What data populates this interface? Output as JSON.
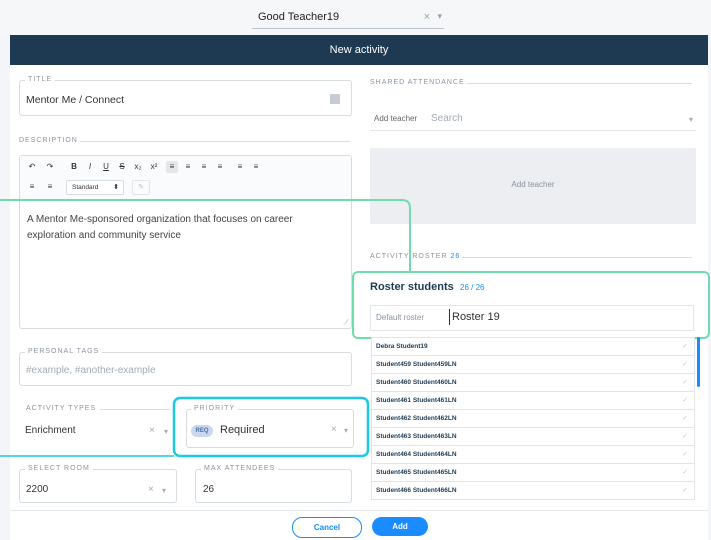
{
  "top": {
    "teacher_value": "Good Teacher19",
    "clear_glyph": "×",
    "chevron_glyph": "▾"
  },
  "header": {
    "title": "New activity"
  },
  "title_field": {
    "label": "TITLE",
    "value": "Mentor Me / Connect"
  },
  "description": {
    "label": "DESCRIPTION",
    "toolbar_row1": [
      "↶",
      "↷",
      "B",
      "I",
      "U",
      "S",
      "x₂",
      "x²",
      "≡",
      "≡",
      "≡",
      "≡",
      "≡",
      "≡"
    ],
    "toolbar_row2": [
      "≡",
      "≡"
    ],
    "style_value": "Standard",
    "text": "A Mentor Me-sponsored organization that focuses on career exploration and community service"
  },
  "personal_tags": {
    "label": "PERSONAL TAGS",
    "placeholder": "#example, #another-example"
  },
  "activity_types": {
    "label": "ACTIVITY TYPES",
    "value": "Enrichment"
  },
  "priority": {
    "label": "PRIORITY",
    "badge": "REQ",
    "value": "Required"
  },
  "select_room": {
    "label": "SELECT ROOM",
    "value": "2200"
  },
  "max_attendees": {
    "label": "MAX ATTENDEES",
    "value": "26"
  },
  "shared_attendance": {
    "label": "SHARED ATTENDANCE",
    "add_teacher_label": "Add teacher",
    "search_placeholder": "Search",
    "add_teacher_box": "Add teacher"
  },
  "activity_roster": {
    "label": "ACTIVITY ROSTER",
    "count": "26"
  },
  "roster_students": {
    "title": "Roster students",
    "count": "26 / 26",
    "default_label": "Default roster",
    "default_value": "Roster 19"
  },
  "students": [
    "Debra Student19",
    "Student459 Student459LN",
    "Student460 Student460LN",
    "Student461 Student461LN",
    "Student462 Student462LN",
    "Student463 Student463LN",
    "Student464 Student464LN",
    "Student465 Student465LN",
    "Student466 Student466LN"
  ],
  "check_glyph": "✓",
  "footer": {
    "cancel": "Cancel",
    "add": "Add"
  },
  "colors": {
    "header": "#1e3a52",
    "accent": "#1a8cff",
    "green_highlight": "#6fdcae",
    "cyan_highlight": "#19c9e6"
  }
}
